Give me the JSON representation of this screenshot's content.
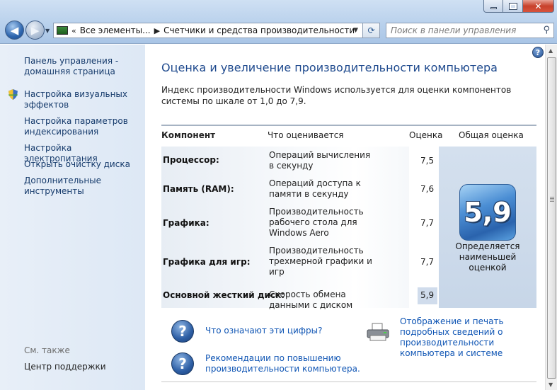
{
  "toolbar": {
    "breadcrumb_prefix": "«",
    "breadcrumb": [
      "Все элементы...",
      "Счетчики и средства производительности"
    ],
    "search_placeholder": "Поиск в панели управления"
  },
  "sidebar": {
    "items": [
      "Панель управления - домашняя страница",
      "Настройка визуальных эффектов",
      "Настройка параметров индексирования",
      "Настройка электропитания",
      "Открыть очистку диска",
      "Дополнительные инструменты"
    ],
    "see_also_label": "См. также",
    "see_also_items": [
      "Центр поддержки"
    ]
  },
  "main": {
    "title": "Оценка и увеличение производительности компьютера",
    "intro": "Индекс производительности Windows используется для оценки компонентов системы по шкале от 1,0 до 7,9.",
    "columns": [
      "Компонент",
      "Что оценивается",
      "Оценка",
      "Общая оценка"
    ],
    "rows": [
      {
        "component": "Процессор:",
        "what": "Операций вычисления в секунду",
        "score": "7,5"
      },
      {
        "component": "Память (RAM):",
        "what": "Операций доступа к памяти в секунду",
        "score": "7,6"
      },
      {
        "component": "Графика:",
        "what": "Производительность рабочего стола для Windows Aero",
        "score": "7,7"
      },
      {
        "component": "Графика для игр:",
        "what": "Производительность трехмерной графики и игр",
        "score": "7,7"
      },
      {
        "component": "Основной жесткий диск:",
        "what": "Скорость обмена данными с диском",
        "score": "5,9"
      }
    ],
    "base_score": "5,9",
    "base_score_caption": "Определяется наименьшей оценкой",
    "links": {
      "what_numbers": "Что означают эти цифры?",
      "print_details": "Отображение и печать подробных сведений о производительности компьютера и системе",
      "recommendations": "Рекомендации по повышению производительности компьютера."
    }
  },
  "icons": [
    "back-arrow-icon",
    "forward-arrow-icon",
    "refresh-icon",
    "search-icon",
    "help-icon",
    "shield-icon",
    "question-icon",
    "printer-icon"
  ],
  "colors": {
    "title": "#1f4a8e",
    "link": "#0f55b4",
    "sidebar_bg": "#dde8f5"
  }
}
